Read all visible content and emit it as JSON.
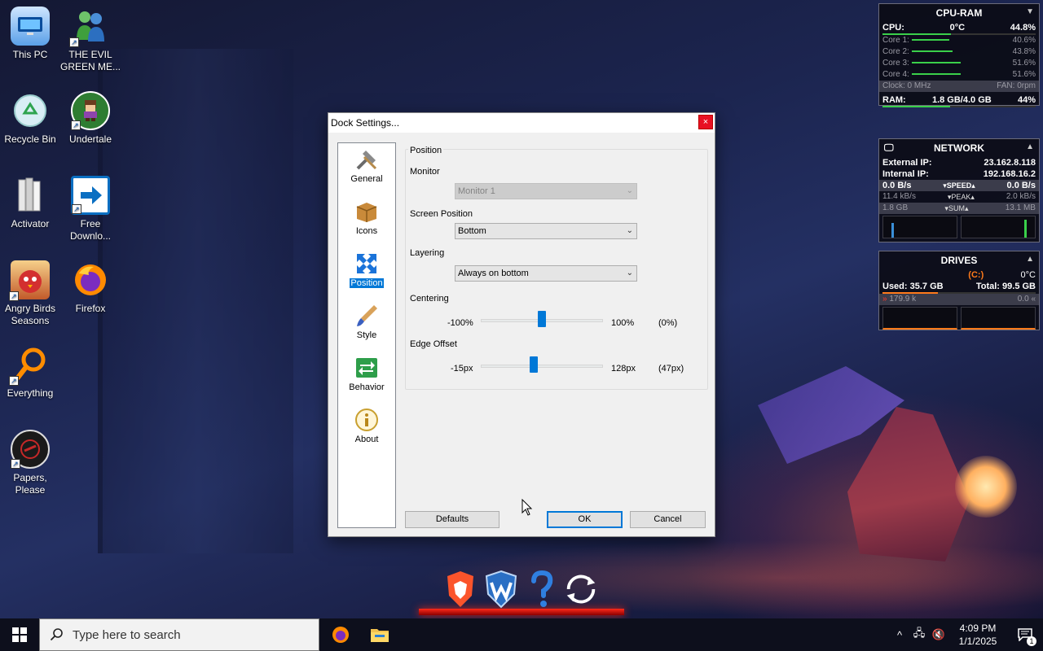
{
  "desktop": {
    "icons": [
      {
        "label": "This PC"
      },
      {
        "label": "THE EVIL GREEN ME..."
      },
      {
        "label": "Recycle Bin"
      },
      {
        "label": "Undertale"
      },
      {
        "label": "Activator"
      },
      {
        "label": "Free Downlo..."
      },
      {
        "label": "Angry Birds Seasons"
      },
      {
        "label": "Firefox"
      },
      {
        "label": "Everything"
      },
      {
        "label": "Papers, Please"
      }
    ]
  },
  "cpu_gadget": {
    "title": "CPU-RAM",
    "cpu_label": "CPU:",
    "cpu_temp": "0°C",
    "cpu_value": "44.8%",
    "cores": [
      {
        "label": "Core 1:",
        "value": "40.6%"
      },
      {
        "label": "Core 2:",
        "value": "43.8%"
      },
      {
        "label": "Core 3:",
        "value": "51.6%"
      },
      {
        "label": "Core 4:",
        "value": "51.6%"
      }
    ],
    "clock": "Clock: 0 MHz",
    "fan": "FAN: 0rpm",
    "ram_label": "RAM:",
    "ram_value": "1.8 GB/4.0 GB",
    "ram_percent": "44%"
  },
  "network_gadget": {
    "title": "NETWORK",
    "external_label": "External IP:",
    "external_ip": "23.162.8.118",
    "internal_label": "Internal IP:",
    "internal_ip": "192.168.16.2",
    "speed_left": "0.0 B/s",
    "speed_label": "SPEED",
    "speed_right": "0.0 B/s",
    "peak_left": "11.4 kB/s",
    "peak_label": "PEAK",
    "peak_right": "2.0 kB/s",
    "sum_left": "1.8 GB",
    "sum_label": "SUM",
    "sum_right": "13.1 MB"
  },
  "drives_gadget": {
    "title": "DRIVES",
    "drive": "(C:)",
    "temp": "0°C",
    "used": "Used: 35.7 GB",
    "total": "Total: 99.5 GB",
    "read": "179.9 k",
    "write": "0.0"
  },
  "dialog": {
    "title": "Dock Settings...",
    "close_glyph": "×",
    "sidebar": [
      {
        "label": "General",
        "icon": "tools-icon"
      },
      {
        "label": "Icons",
        "icon": "box-icon"
      },
      {
        "label": "Position",
        "icon": "position-arrows-icon",
        "active": true
      },
      {
        "label": "Style",
        "icon": "brush-icon"
      },
      {
        "label": "Behavior",
        "icon": "behavior-arrows-icon"
      },
      {
        "label": "About",
        "icon": "info-icon"
      }
    ],
    "group_title": "Position",
    "monitor_label": "Monitor",
    "monitor_value": "Monitor 1",
    "screen_position_label": "Screen Position",
    "screen_position_value": "Bottom",
    "layering_label": "Layering",
    "layering_value": "Always on bottom",
    "centering_label": "Centering",
    "centering_min": "-100%",
    "centering_max": "100%",
    "centering_value": "(0%)",
    "centering_fraction": 0.5,
    "edge_offset_label": "Edge Offset",
    "edge_min": "-15px",
    "edge_max": "128px",
    "edge_value": "(47px)",
    "edge_fraction": 0.434,
    "defaults_label": "Defaults",
    "ok_label": "OK",
    "cancel_label": "Cancel"
  },
  "dock": {
    "items": [
      "brave-icon",
      "wise-care-icon",
      "help-icon",
      "refresh-icon"
    ]
  },
  "taskbar": {
    "search_placeholder": "Type here to search",
    "time": "4:09 PM",
    "date": "1/1/2025",
    "notification_count": "1"
  },
  "colors": {
    "accent": "#0078d7",
    "dock_glow": "#ff2a1a",
    "close": "#e81123"
  }
}
